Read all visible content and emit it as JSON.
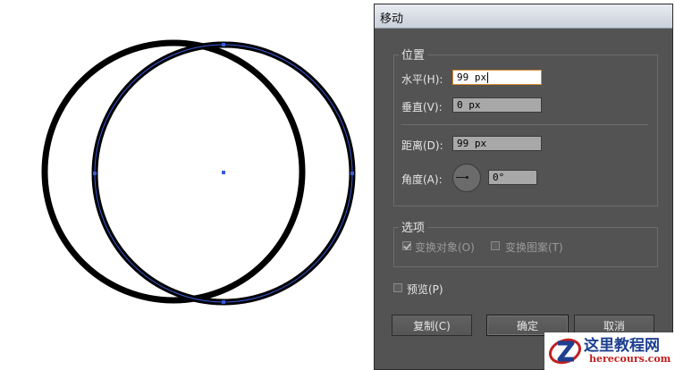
{
  "dialog": {
    "title": "移动",
    "position_group": {
      "title": "位置",
      "horizontal": {
        "label": "水平(H):",
        "value": "99 px"
      },
      "vertical": {
        "label": "垂直(V):",
        "value": "0 px"
      },
      "distance": {
        "label": "距离(D):",
        "value": "99 px"
      },
      "angle": {
        "label": "角度(A):",
        "value": "0°"
      }
    },
    "options_group": {
      "title": "选项",
      "transform_objects": {
        "label": "变换对象(O)",
        "checked": true
      },
      "transform_patterns": {
        "label": "变换图案(T)",
        "checked": false
      }
    },
    "preview": {
      "label": "预览(P)",
      "checked": false
    },
    "buttons": {
      "copy": "复制(C)",
      "ok": "确定",
      "cancel": "取消"
    }
  },
  "watermark": {
    "text": "这里教程网",
    "url": "herecours.com"
  },
  "colors": {
    "stroke": "#000000",
    "selection": "#3b5bdb",
    "dialog_bg": "#535353"
  }
}
